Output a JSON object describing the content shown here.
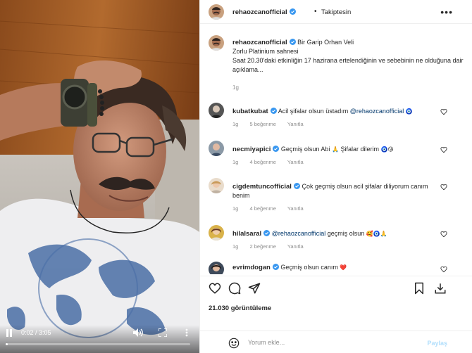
{
  "video": {
    "time_current": "0:02",
    "time_total": "3:05",
    "time_text": "0:02 / 3:05",
    "progress": 0.011,
    "icons": [
      "pause-icon",
      "volume-icon",
      "fullscreen-icon",
      "more-vertical-icon"
    ]
  },
  "header": {
    "username": "rehaozcanofficial",
    "follow_status": "Takiptesin",
    "more": "•••"
  },
  "caption": {
    "username": "rehaozcanofficial",
    "line1": "Bir Garip Orhan Veli",
    "line2": "Zorlu Platinium sahnesi",
    "line3": "Saat 20.30'daki etkinliğin 17 hazirana ertelendiğinin ve sebebinin ne olduğuna dair açıklama...",
    "time": "1g"
  },
  "comments": [
    {
      "username": "kubatkubat",
      "text": "Acil şifalar olsun üstadım",
      "mention": "@rehaozcanofficial",
      "emoji": "🧿",
      "time": "1g",
      "likes": "5 beğenme",
      "reply": "Yanıtla"
    },
    {
      "username": "necmiyapici",
      "text": "Geçmiş olsun Abi",
      "emoji1": "🙏",
      "text2": "Şifalar dilerim",
      "emoji2": "🧿😘",
      "time": "1g",
      "likes": "4 beğenme",
      "reply": "Yanıtla"
    },
    {
      "username": "cigdemtuncofficial",
      "text": "Çok geçmiş olsun acil şifalar diliyorum canım benim",
      "time": "1g",
      "likes": "4 beğenme",
      "reply": "Yanıtla"
    },
    {
      "username": "hilalsaral",
      "mention": "@rehaozcanofficial",
      "text": "geçmiş olsun",
      "emoji": "🥰🧿🙏",
      "time": "1g",
      "likes": "2 beğenme",
      "reply": "Yanıtla"
    },
    {
      "username": "evrimdogan",
      "text": "Geçmiş olsun canım",
      "emoji": "❤️"
    }
  ],
  "actions": {
    "views": "21.030 görüntüleme",
    "icons": [
      "heart-icon",
      "comment-icon",
      "share-icon",
      "bookmark-icon",
      "download-icon"
    ]
  },
  "add_comment": {
    "placeholder": "Yorum ekle...",
    "share_label": "Paylaş"
  },
  "colors": {
    "verified": "#3897f0",
    "mention": "#00376b",
    "muted": "#8e8e8e",
    "share_disabled": "#b2dffc"
  }
}
